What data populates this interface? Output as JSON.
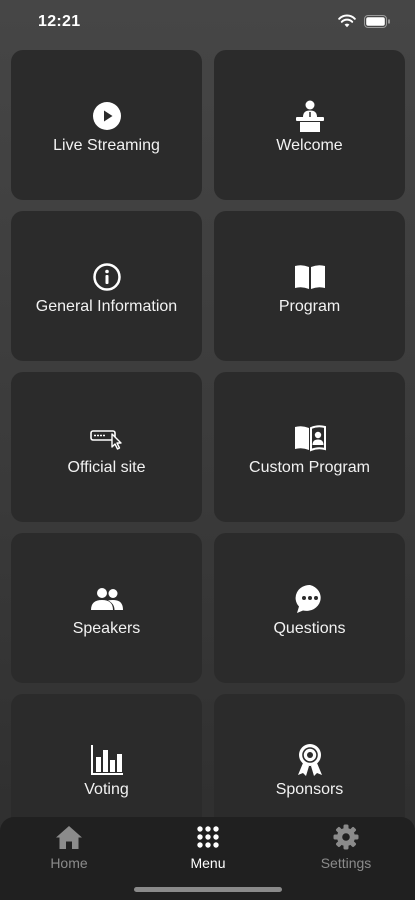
{
  "status_bar": {
    "time": "12:21",
    "icons": [
      "wifi-icon",
      "battery-icon"
    ]
  },
  "menu_tiles": [
    {
      "label": "Live Streaming",
      "icon": "play-circle-icon"
    },
    {
      "label": "Welcome",
      "icon": "speaker-podium-icon"
    },
    {
      "label": "General Information",
      "icon": "info-circle-icon"
    },
    {
      "label": "Program",
      "icon": "open-book-icon"
    },
    {
      "label": "Official site",
      "icon": "website-cursor-icon"
    },
    {
      "label": "Custom Program",
      "icon": "book-user-icon"
    },
    {
      "label": "Speakers",
      "icon": "users-icon"
    },
    {
      "label": "Questions",
      "icon": "chat-bubble-icon"
    },
    {
      "label": "Voting",
      "icon": "bar-chart-icon"
    },
    {
      "label": "Sponsors",
      "icon": "award-medal-icon"
    }
  ],
  "tab_bar": {
    "tabs": [
      {
        "label": "Home",
        "icon": "home-icon",
        "active": false
      },
      {
        "label": "Menu",
        "icon": "grid-dots-icon",
        "active": true
      },
      {
        "label": "Settings",
        "icon": "gear-icon",
        "active": false
      }
    ]
  },
  "colors": {
    "background_top": "#464646",
    "tile": "#2b2b2b",
    "tab_bar": "#202020",
    "active_tab": "#ffffff",
    "inactive_tab": "#8b8b8b"
  }
}
